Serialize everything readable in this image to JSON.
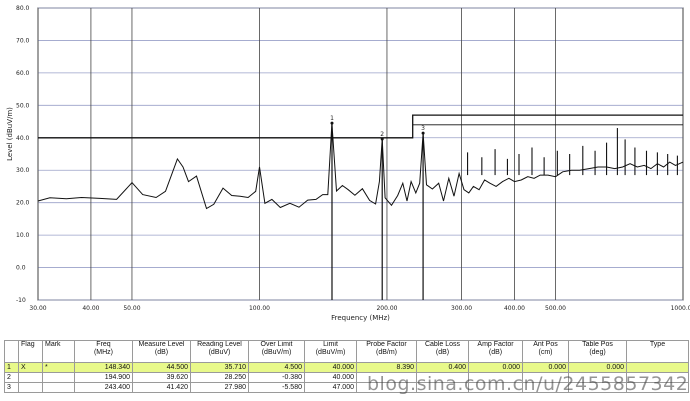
{
  "chart_data": {
    "type": "line",
    "xlabel": "Frequency (MHz)",
    "ylabel": "Level (dBuV/m)",
    "x_scale": "log",
    "xlim": [
      30,
      1000
    ],
    "ylim": [
      -10,
      80
    ],
    "x_ticks": [
      30,
      40,
      50,
      100,
      200,
      300,
      400,
      500,
      1000
    ],
    "x_tick_labels": [
      "30.00",
      "40.00",
      "50.00",
      "100.00",
      "200.00",
      "300.00",
      "400.00",
      "500.00",
      "1000.00"
    ],
    "y_ticks": [
      -10,
      0,
      10,
      20,
      30,
      40,
      50,
      60,
      70,
      80
    ],
    "y_tick_labels": [
      "-10",
      "0.0",
      "10.0",
      "20.0",
      "30.0",
      "40.0",
      "50.0",
      "60.0",
      "70.0",
      "80.0"
    ],
    "grid": true,
    "limit_line": {
      "name": "Limit",
      "x": [
        30,
        230,
        230,
        1000
      ],
      "y": [
        40,
        40,
        47,
        47
      ],
      "color": "#111111"
    },
    "markers": [
      {
        "label": "1",
        "x": 148.34,
        "y": 44.5
      },
      {
        "label": "2",
        "x": 194.9,
        "y": 39.62
      },
      {
        "label": "3",
        "x": 243.4,
        "y": 41.42
      }
    ],
    "series": [
      {
        "color": "#111111",
        "x": [
          30,
          32,
          35,
          38,
          42,
          46,
          50,
          53,
          57,
          60,
          64,
          66,
          68,
          71,
          75,
          78,
          82,
          86,
          90,
          94,
          98,
          100,
          103,
          107,
          112,
          118,
          124,
          130,
          136,
          141,
          145,
          148.3,
          152,
          157,
          162,
          168,
          175,
          182,
          188,
          192,
          194.9,
          198,
          205,
          212,
          218,
          223,
          228,
          234,
          239,
          243.4,
          248,
          256,
          265,
          272,
          280,
          288,
          296,
          304,
          312,
          320,
          330,
          340,
          350,
          362,
          375,
          388,
          400,
          415,
          430,
          445,
          460,
          480,
          500,
          520,
          545,
          570,
          600,
          630,
          660,
          690,
          720,
          750,
          780,
          810,
          840,
          870,
          900,
          930,
          960,
          1000
        ],
        "y": [
          20.5,
          21.5,
          21.2,
          21.6,
          21.3,
          21.0,
          26.2,
          22.5,
          21.6,
          23.5,
          33.5,
          31.0,
          26.5,
          28.2,
          18.2,
          19.5,
          24.5,
          22.2,
          22.0,
          21.6,
          23.5,
          31.0,
          19.8,
          21.0,
          18.5,
          19.8,
          18.6,
          20.8,
          21.0,
          22.5,
          22.5,
          44.5,
          23.6,
          25.3,
          24.0,
          22.3,
          24.3,
          20.7,
          19.6,
          26.5,
          39.62,
          21.5,
          19.2,
          22.2,
          26.0,
          20.5,
          26.5,
          23.0,
          26.0,
          41.42,
          25.5,
          24.2,
          26.0,
          20.5,
          27.5,
          22.0,
          29.0,
          24.0,
          23.0,
          25.0,
          24.0,
          27.0,
          26.0,
          25.0,
          26.5,
          27.5,
          26.5,
          27.0,
          28.0,
          27.5,
          28.5,
          28.5,
          28.0,
          29.5,
          30.0,
          30.0,
          30.5,
          31.0,
          31.0,
          30.5,
          31.0,
          32.0,
          31.0,
          31.5,
          30.5,
          32.0,
          31.0,
          32.5,
          31.5,
          32.5
        ]
      }
    ],
    "spikes": [
      {
        "x": 310,
        "y": 35.5
      },
      {
        "x": 335,
        "y": 34.0
      },
      {
        "x": 360,
        "y": 36.5
      },
      {
        "x": 385,
        "y": 33.5
      },
      {
        "x": 410,
        "y": 35.0
      },
      {
        "x": 440,
        "y": 37.0
      },
      {
        "x": 470,
        "y": 34.0
      },
      {
        "x": 505,
        "y": 36.0
      },
      {
        "x": 540,
        "y": 35.0
      },
      {
        "x": 580,
        "y": 37.5
      },
      {
        "x": 620,
        "y": 36.0
      },
      {
        "x": 660,
        "y": 38.5
      },
      {
        "x": 700,
        "y": 43.0
      },
      {
        "x": 730,
        "y": 39.5
      },
      {
        "x": 770,
        "y": 37.0
      },
      {
        "x": 820,
        "y": 36.0
      },
      {
        "x": 870,
        "y": 35.5
      },
      {
        "x": 920,
        "y": 35.0
      },
      {
        "x": 970,
        "y": 34.5
      }
    ]
  },
  "table": {
    "headers": [
      {
        "line1": "",
        "line2": ""
      },
      {
        "line1": "Flag",
        "line2": ""
      },
      {
        "line1": "Mark",
        "line2": ""
      },
      {
        "line1": "Freq",
        "line2": "(MHz)"
      },
      {
        "line1": "Measure Level",
        "line2": "(dB)"
      },
      {
        "line1": "Reading Level",
        "line2": "(dBuV)"
      },
      {
        "line1": "Over Limit",
        "line2": "(dBuV/m)"
      },
      {
        "line1": "Limit",
        "line2": "(dBuV/m)"
      },
      {
        "line1": "Probe Factor",
        "line2": "(dB/m)"
      },
      {
        "line1": "Cable Loss",
        "line2": "(dB)"
      },
      {
        "line1": "Amp Factor",
        "line2": "(dB)"
      },
      {
        "line1": "Ant Pos",
        "line2": "(cm)"
      },
      {
        "line1": "Table Pos",
        "line2": "(deg)"
      },
      {
        "line1": "Type",
        "line2": ""
      }
    ],
    "rows": [
      [
        "1",
        "X",
        "*",
        "148.340",
        "44.500",
        "35.710",
        "4.500",
        "40.000",
        "8.390",
        "0.400",
        "0.000",
        "0.000",
        "0.000",
        ""
      ],
      [
        "2",
        "",
        "",
        "194.900",
        "39.620",
        "28.250",
        "-0.380",
        "40.000",
        "",
        "",
        "",
        "",
        "",
        ""
      ],
      [
        "3",
        "",
        "",
        "243.400",
        "41.420",
        "27.980",
        "-5.580",
        "47.000",
        "",
        "",
        "",
        "",
        "",
        ""
      ]
    ],
    "selected_row": 0
  },
  "watermark": "blog.sina.com.cn/u/2455857342"
}
